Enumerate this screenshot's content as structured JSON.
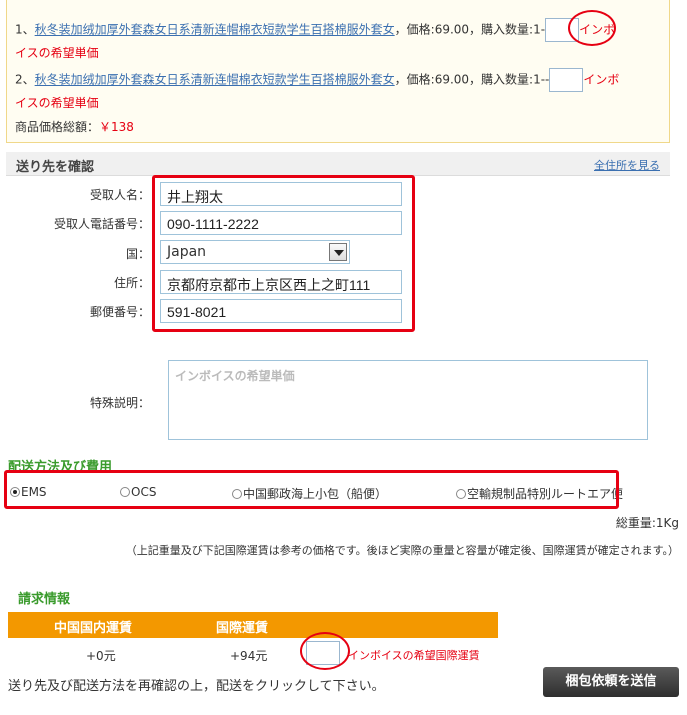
{
  "orders": [
    {
      "index": "1、",
      "name": "秋冬装加绒加厚外套森女日系清新连帽棉衣短款学生百搭棉服外套女",
      "price": "，価格:69.00，購入数量:1-",
      "invoice_note_a": "インボ",
      "invoice_note_b": "イスの希望単価"
    },
    {
      "index": "2、",
      "name": "秋冬装加绒加厚外套森女日系清新连帽棉衣短款学生百搭棉服外套女",
      "price": "，価格:69.00，購入数量:1--",
      "invoice_note_a": "インボ",
      "invoice_note_b": "イスの希望単価"
    }
  ],
  "total": {
    "label": "商品価格総額：",
    "value": "￥138"
  },
  "address": {
    "section_title": "送り先を確認",
    "view_all": "全住所を見る",
    "recipient_label": "受取人名：",
    "recipient_value": "井上翔太",
    "phone_label": "受取人電話番号：",
    "phone_value": "090-1111-2222",
    "country_label": "国：",
    "country_value": "Japan",
    "address_label": "住所：",
    "address_value": "京都府京都市上京区西上之町111",
    "zip_label": "郵便番号：",
    "zip_value": "591-8021",
    "note_label": "特殊説明：",
    "note_placeholder": "インボイスの希望単価"
  },
  "shipping": {
    "title": "配送方法及び費用",
    "options": [
      "EMS",
      "OCS",
      "中国郵政海上小包（船便）",
      "空輸規制品特別ルートエア便"
    ],
    "selected": "EMS",
    "weight": "総重量:1Kg",
    "notice": "（上記重量及び下記国際運賃は参考の価格です。後ほど実際の重量と容量が確定後、国際運賃が確定されます。）"
  },
  "billing": {
    "title": "請求情報",
    "domestic_header": "中国国内運賃",
    "intl_header": "国際運賃",
    "domestic_value": "+0元",
    "intl_value": "+94元",
    "hope_label": "インボイスの希望国際運賃"
  },
  "footer": {
    "instruction": "送り先及び配送方法を再確認の上，配送をクリックして下さい。",
    "submit_label": "梱包依頼を送信"
  },
  "colors": {
    "accent_red": "#e60012",
    "orange": "#f39800",
    "green": "#3a9b2c",
    "link": "#3a6fb0"
  }
}
